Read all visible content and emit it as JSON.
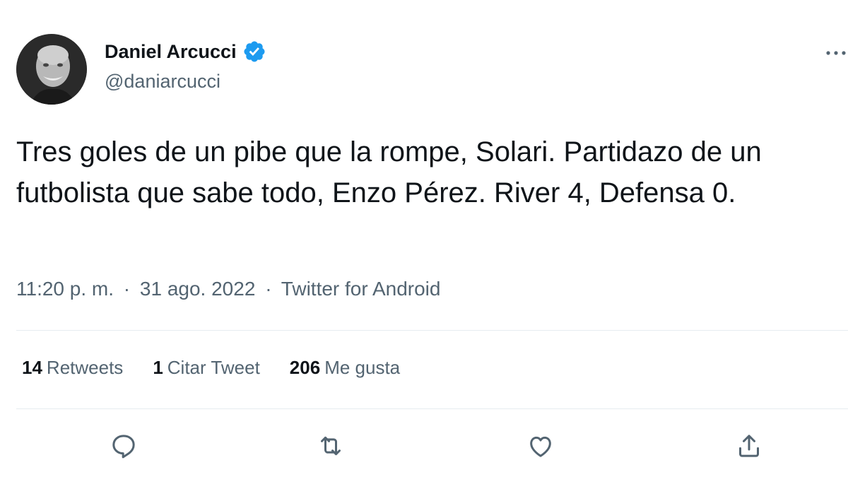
{
  "author": {
    "display_name": "Daniel Arcucci",
    "handle": "@daniarcucci",
    "verified": true
  },
  "tweet": {
    "text": "Tres goles de un pibe que la rompe, Solari. Partidazo de un futbolista que sabe todo, Enzo Pérez. River 4, Defensa 0.",
    "time": "11:20 p. m.",
    "date": "31 ago. 2022",
    "source": "Twitter for Android",
    "separator": "·"
  },
  "stats": {
    "retweets_count": "14",
    "retweets_label": "Retweets",
    "quotes_count": "1",
    "quotes_label": "Citar Tweet",
    "likes_count": "206",
    "likes_label": "Me gusta"
  },
  "icons": {
    "reply": "reply-icon",
    "retweet": "retweet-icon",
    "like": "heart-icon",
    "share": "share-icon",
    "more": "more-icon",
    "verified": "verified-badge-icon"
  },
  "colors": {
    "verified": "#1d9bf0",
    "text": "#0f1419",
    "secondary": "#536471",
    "divider": "#e6ecf0"
  }
}
